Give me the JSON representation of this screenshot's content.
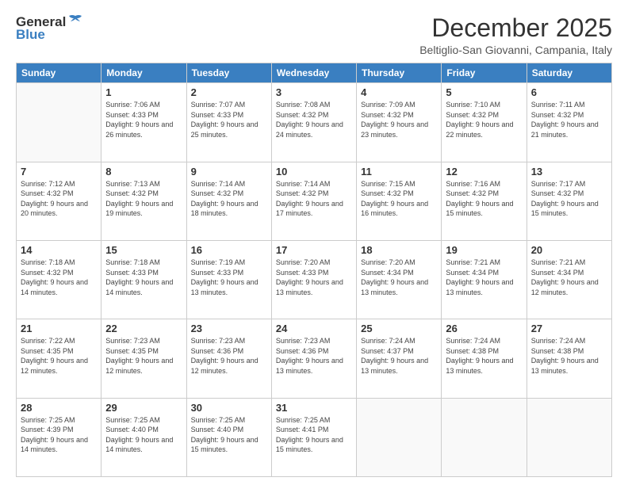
{
  "header": {
    "logo_general": "General",
    "logo_blue": "Blue",
    "title": "December 2025",
    "subtitle": "Beltiglio-San Giovanni, Campania, Italy"
  },
  "days_of_week": [
    "Sunday",
    "Monday",
    "Tuesday",
    "Wednesday",
    "Thursday",
    "Friday",
    "Saturday"
  ],
  "weeks": [
    [
      {
        "day": "",
        "info": ""
      },
      {
        "day": "1",
        "sunrise": "7:06 AM",
        "sunset": "4:33 PM",
        "daylight": "9 hours and 26 minutes."
      },
      {
        "day": "2",
        "sunrise": "7:07 AM",
        "sunset": "4:33 PM",
        "daylight": "9 hours and 25 minutes."
      },
      {
        "day": "3",
        "sunrise": "7:08 AM",
        "sunset": "4:32 PM",
        "daylight": "9 hours and 24 minutes."
      },
      {
        "day": "4",
        "sunrise": "7:09 AM",
        "sunset": "4:32 PM",
        "daylight": "9 hours and 23 minutes."
      },
      {
        "day": "5",
        "sunrise": "7:10 AM",
        "sunset": "4:32 PM",
        "daylight": "9 hours and 22 minutes."
      },
      {
        "day": "6",
        "sunrise": "7:11 AM",
        "sunset": "4:32 PM",
        "daylight": "9 hours and 21 minutes."
      }
    ],
    [
      {
        "day": "7",
        "sunrise": "7:12 AM",
        "sunset": "4:32 PM",
        "daylight": "9 hours and 20 minutes."
      },
      {
        "day": "8",
        "sunrise": "7:13 AM",
        "sunset": "4:32 PM",
        "daylight": "9 hours and 19 minutes."
      },
      {
        "day": "9",
        "sunrise": "7:14 AM",
        "sunset": "4:32 PM",
        "daylight": "9 hours and 18 minutes."
      },
      {
        "day": "10",
        "sunrise": "7:14 AM",
        "sunset": "4:32 PM",
        "daylight": "9 hours and 17 minutes."
      },
      {
        "day": "11",
        "sunrise": "7:15 AM",
        "sunset": "4:32 PM",
        "daylight": "9 hours and 16 minutes."
      },
      {
        "day": "12",
        "sunrise": "7:16 AM",
        "sunset": "4:32 PM",
        "daylight": "9 hours and 15 minutes."
      },
      {
        "day": "13",
        "sunrise": "7:17 AM",
        "sunset": "4:32 PM",
        "daylight": "9 hours and 15 minutes."
      }
    ],
    [
      {
        "day": "14",
        "sunrise": "7:18 AM",
        "sunset": "4:32 PM",
        "daylight": "9 hours and 14 minutes."
      },
      {
        "day": "15",
        "sunrise": "7:18 AM",
        "sunset": "4:33 PM",
        "daylight": "9 hours and 14 minutes."
      },
      {
        "day": "16",
        "sunrise": "7:19 AM",
        "sunset": "4:33 PM",
        "daylight": "9 hours and 13 minutes."
      },
      {
        "day": "17",
        "sunrise": "7:20 AM",
        "sunset": "4:33 PM",
        "daylight": "9 hours and 13 minutes."
      },
      {
        "day": "18",
        "sunrise": "7:20 AM",
        "sunset": "4:34 PM",
        "daylight": "9 hours and 13 minutes."
      },
      {
        "day": "19",
        "sunrise": "7:21 AM",
        "sunset": "4:34 PM",
        "daylight": "9 hours and 13 minutes."
      },
      {
        "day": "20",
        "sunrise": "7:21 AM",
        "sunset": "4:34 PM",
        "daylight": "9 hours and 12 minutes."
      }
    ],
    [
      {
        "day": "21",
        "sunrise": "7:22 AM",
        "sunset": "4:35 PM",
        "daylight": "9 hours and 12 minutes."
      },
      {
        "day": "22",
        "sunrise": "7:23 AM",
        "sunset": "4:35 PM",
        "daylight": "9 hours and 12 minutes."
      },
      {
        "day": "23",
        "sunrise": "7:23 AM",
        "sunset": "4:36 PM",
        "daylight": "9 hours and 12 minutes."
      },
      {
        "day": "24",
        "sunrise": "7:23 AM",
        "sunset": "4:36 PM",
        "daylight": "9 hours and 13 minutes."
      },
      {
        "day": "25",
        "sunrise": "7:24 AM",
        "sunset": "4:37 PM",
        "daylight": "9 hours and 13 minutes."
      },
      {
        "day": "26",
        "sunrise": "7:24 AM",
        "sunset": "4:38 PM",
        "daylight": "9 hours and 13 minutes."
      },
      {
        "day": "27",
        "sunrise": "7:24 AM",
        "sunset": "4:38 PM",
        "daylight": "9 hours and 13 minutes."
      }
    ],
    [
      {
        "day": "28",
        "sunrise": "7:25 AM",
        "sunset": "4:39 PM",
        "daylight": "9 hours and 14 minutes."
      },
      {
        "day": "29",
        "sunrise": "7:25 AM",
        "sunset": "4:40 PM",
        "daylight": "9 hours and 14 minutes."
      },
      {
        "day": "30",
        "sunrise": "7:25 AM",
        "sunset": "4:40 PM",
        "daylight": "9 hours and 15 minutes."
      },
      {
        "day": "31",
        "sunrise": "7:25 AM",
        "sunset": "4:41 PM",
        "daylight": "9 hours and 15 minutes."
      },
      {
        "day": "",
        "info": ""
      },
      {
        "day": "",
        "info": ""
      },
      {
        "day": "",
        "info": ""
      }
    ]
  ],
  "labels": {
    "sunrise": "Sunrise:",
    "sunset": "Sunset:",
    "daylight": "Daylight:"
  }
}
